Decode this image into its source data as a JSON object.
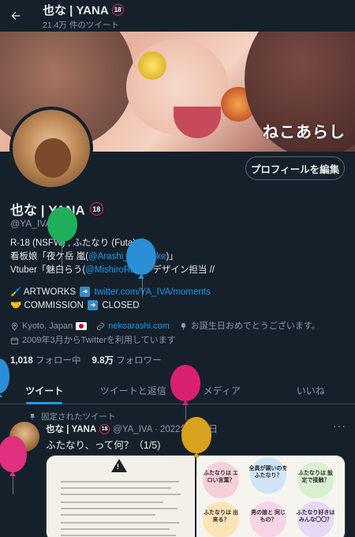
{
  "header": {
    "name": "也な | YANA",
    "badge": "18",
    "tweet_count": "21.4万 件のツイート"
  },
  "banner": {
    "logo_text": "ねこあらし"
  },
  "profile": {
    "edit_button": "プロフィールを編集",
    "name": "也な | YANA",
    "badge": "18",
    "handle": "@YA_IVA",
    "bio_line1": "R-18 (NSFW) , ふたなり (Futa) //",
    "bio_line2_pre": "看板娘「夜ケ岳 嵐(",
    "bio_line2_link": "@Arashi_Yagatake",
    "bio_line2_post": ")」",
    "bio_line3_pre": "Vtuber「魅白らう(",
    "bio_line3_link": "@MishiroRau",
    "bio_line3_post": ")」デザイン担当 //",
    "artworks_label": "🖌️ ARTWORKS",
    "artworks_link": "twitter.com/YA_IVA/moments",
    "commission_label": "🤝 COMMISSION",
    "commission_status": "CLOSED",
    "location": "Kyoto, Japan",
    "website": "nekoarashi.com",
    "birthday": "お誕生日おめでとうございます。",
    "joined": "2009年3月からTwitterを利用しています",
    "following_count": "1,018",
    "following_label": "フォロー中",
    "followers_count": "9.8万",
    "followers_label": "フォロワー"
  },
  "tabs": [
    "ツイート",
    "ツイートと返信",
    "メディア",
    "いいね"
  ],
  "pinned_tweet": {
    "pinned_label": "固定されたツイート",
    "author": "也な | YANA",
    "badge": "18",
    "handle_date": "@YA_IVA · 2022年6月2日",
    "text": "ふたなり、って何？（1/5)",
    "media_right_captions": [
      "ふたなりは エロい言葉？",
      "全員が親いのを ふたなり？",
      "ふたなりは 設定で接触？",
      "ふたなりは 出来る？",
      "男の娘と 同じもの？",
      "ふたなり好きは みんな〇〇？"
    ]
  },
  "colors": {
    "background": "#15202b",
    "accent": "#1d9bf0",
    "muted": "#8b98a5",
    "balloon_green": "#1fae5a",
    "balloon_blue": "#2b8fd6",
    "balloon_pink": "#d8206e",
    "balloon_magenta": "#e0307f",
    "balloon_gold": "#d9a21c"
  }
}
